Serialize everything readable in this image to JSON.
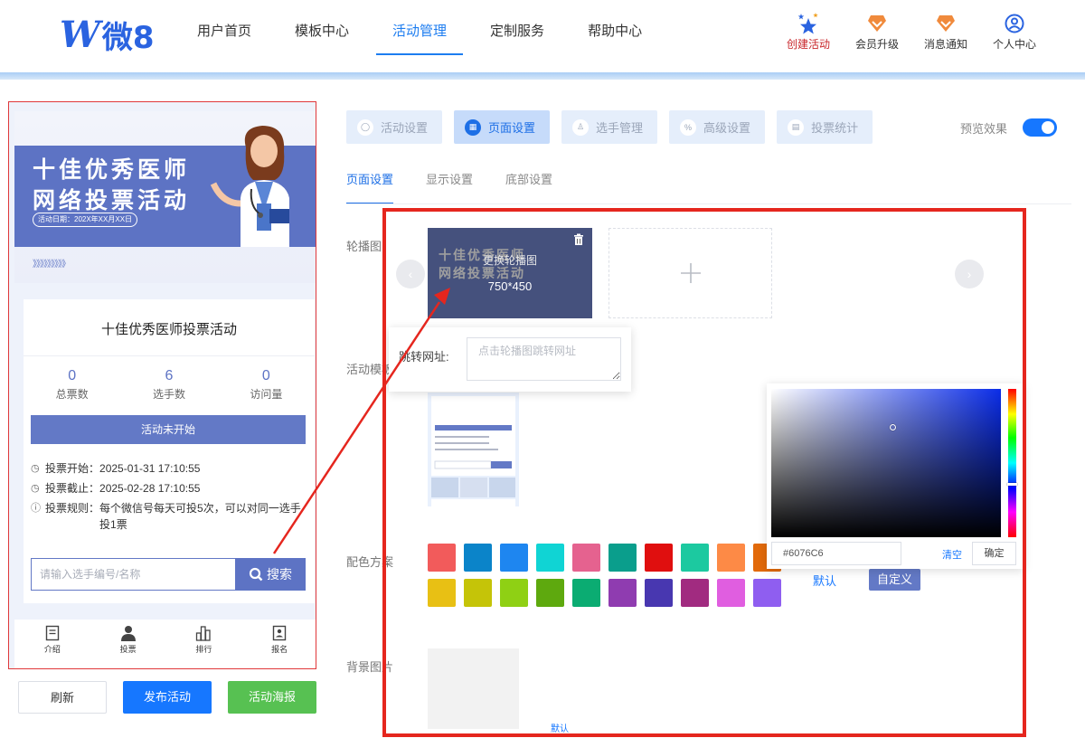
{
  "brand": {
    "logo_mark": "W",
    "logo_text": "微8",
    "accent": "#1d7df0"
  },
  "nav": {
    "items": [
      {
        "label": "用户首页"
      },
      {
        "label": "模板中心"
      },
      {
        "label": "活动管理",
        "active": true
      },
      {
        "label": "定制服务"
      },
      {
        "label": "帮助中心"
      }
    ]
  },
  "toolbar": {
    "create": {
      "label": "创建活动",
      "icon": "stars-icon"
    },
    "upgrade": {
      "label": "会员升级",
      "icon": "diamond-badge-icon"
    },
    "messages": {
      "label": "消息通知",
      "icon": "diamond-badge-icon"
    },
    "profile": {
      "label": "个人中心",
      "icon": "user-circle-icon"
    }
  },
  "preview": {
    "banner": {
      "title_line1": "十佳优秀医师",
      "title_line2": "网络投票活动",
      "date": "活动日期：202X年XX月XX日",
      "arrows": "》》》》》》》》》"
    },
    "title": "十佳优秀医师投票活动",
    "stats": [
      {
        "value": "0",
        "label": "总票数"
      },
      {
        "value": "6",
        "label": "选手数"
      },
      {
        "value": "0",
        "label": "访问量"
      }
    ],
    "status_button": "活动未开始",
    "meta": {
      "start_label": "投票开始：",
      "start_value": "2025-01-31 17:10:55",
      "end_label": "投票截止：",
      "end_value": "2025-02-28 17:10:55",
      "rule_label": "投票规则：",
      "rule_value": "每个微信号每天可投5次，可以对同一选手投1票"
    },
    "search": {
      "placeholder": "请输入选手编号/名称",
      "button": "搜索"
    },
    "tabbar": [
      {
        "label": "介绍",
        "icon": "document-icon"
      },
      {
        "label": "投票",
        "icon": "person-icon"
      },
      {
        "label": "排行",
        "icon": "bar-chart-icon"
      },
      {
        "label": "报名",
        "icon": "id-card-icon"
      }
    ],
    "theme_color": "#5d73c4"
  },
  "bottom_buttons": {
    "refresh": "刷新",
    "publish": "发布活动",
    "poster": "活动海报"
  },
  "config": {
    "tabs": [
      {
        "label": "活动设置"
      },
      {
        "label": "页面设置",
        "active": true
      },
      {
        "label": "选手管理"
      },
      {
        "label": "高级设置"
      },
      {
        "label": "投票统计"
      }
    ],
    "preview_toggle": {
      "label": "预览效果",
      "on": true
    },
    "sub_tabs": [
      {
        "label": "页面设置",
        "active": true
      },
      {
        "label": "显示设置"
      },
      {
        "label": "底部设置"
      }
    ],
    "labels": {
      "carousel": "轮播图",
      "template": "活动模板",
      "color_scheme": "配色方案",
      "background": "背景图片"
    },
    "carousel": {
      "thumb_title1": "十佳优秀医师",
      "thumb_title2": "网络投票活动",
      "change_text": "更换轮播图",
      "size_text": "750*450"
    },
    "url_popover": {
      "label": "跳转网址:",
      "placeholder": "点击轮播图跳转网址"
    },
    "swatches_row1": [
      "#f25b5b",
      "#0b84c9",
      "#1e86f0",
      "#10d4d4",
      "#e5628f",
      "#0a9e8c",
      "#e00f0f",
      "#1cc9a0",
      "#fd8a46",
      "#e26a0a"
    ],
    "swatches_row2": [
      "#e8c014",
      "#c5c408",
      "#8fd014",
      "#5ea90e",
      "#0bac72",
      "#8f3cb0",
      "#4837b0",
      "#a12b80",
      "#e05ee0",
      "#8f5ef0"
    ],
    "scheme_buttons": {
      "default": "默认",
      "custom": "自定义"
    },
    "color_picker": {
      "value": "#6076C6",
      "clear": "清空",
      "confirm": "确定"
    },
    "background_default": "默认"
  }
}
